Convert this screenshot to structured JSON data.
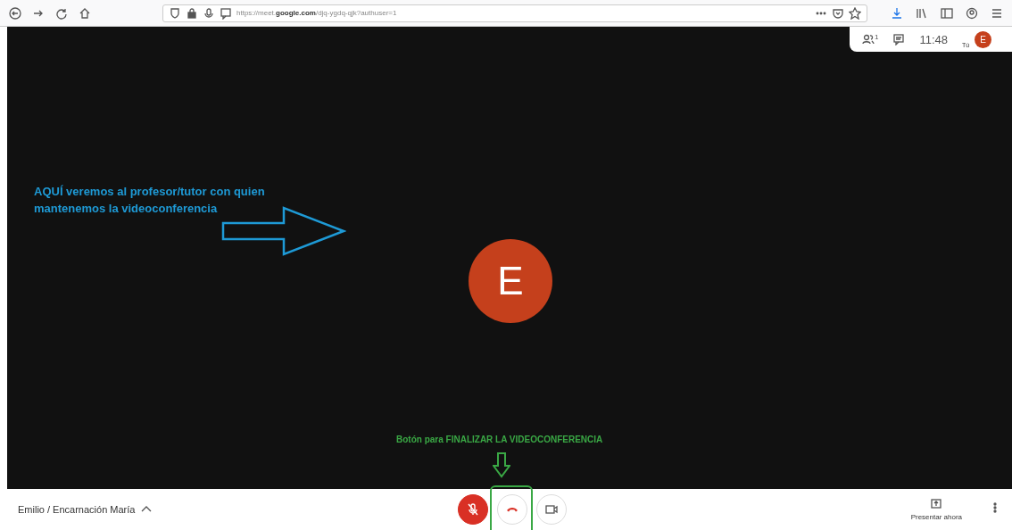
{
  "browser": {
    "url": "https://meet.**google.com**/djq-ygdq-qjk?authuser=1"
  },
  "meeting_info": {
    "participants_count": "1",
    "time": "11:48",
    "self_label": "Tú",
    "self_avatar": "E"
  },
  "stage": {
    "avatar": "E"
  },
  "annotations": [
    {
      "kind": "right-arrow",
      "text": "AQUÍ veremos al profesor/tutor con quien mantenemos la videoconferencia",
      "color": "#1e9ad6"
    },
    {
      "kind": "down-arrow",
      "text": "Botón para FINALIZAR LA VIDEOCONFERENCIA",
      "color": "#3aa845"
    }
  ],
  "controls": {
    "meeting_name": "Emilio / Encarnación María",
    "mic_muted": true,
    "present_label": "Presentar ahora"
  }
}
